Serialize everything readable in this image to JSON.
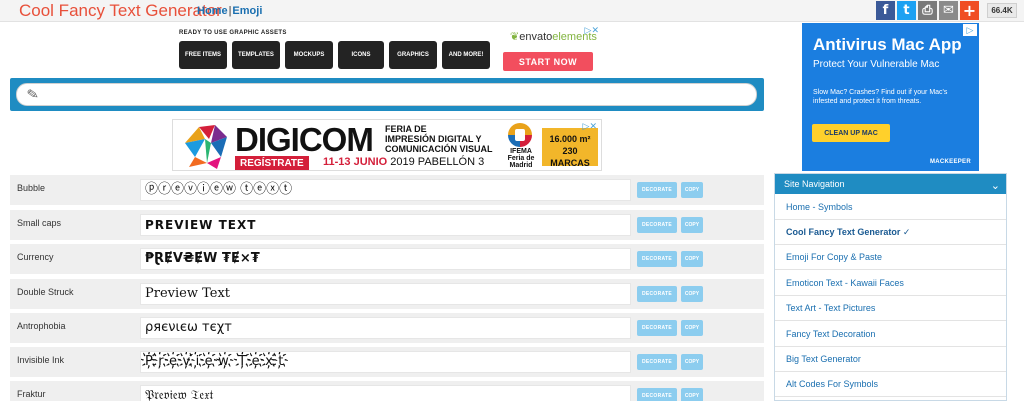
{
  "header": {
    "logo": "Cool Fancy Text Generator",
    "nav": {
      "home": "Home",
      "separator": "|",
      "emoji": "Emoji"
    },
    "share": {
      "facebook": "f",
      "twitter": "t",
      "print": "⎙",
      "email": "✉",
      "plus": "+",
      "count": "66.4K"
    }
  },
  "envato_ad": {
    "kicker": "READY TO USE GRAPHIC ASSETS",
    "chips": [
      "FREE ITEMS",
      "TEMPLATES",
      "MOCKUPS",
      "ICONS",
      "GRAPHICS",
      "AND MORE!"
    ],
    "brand_main": "envato",
    "brand_suffix": "elements",
    "cta": "START NOW",
    "ad_mark": "▷✕"
  },
  "input": {
    "icon": "pencil-icon",
    "glyph": "✎",
    "value": ""
  },
  "digicom_ad": {
    "headline": "DIGICOM",
    "subtitle_1": "FERIA DE",
    "subtitle_2": "IMPRESIÓN DIGITAL Y",
    "subtitle_3": "COMUNICACIÓN VISUAL",
    "register": "REGÍSTRATE",
    "dates": "11-13 JUNIO",
    "year_place": "2019 PABELLÓN 3",
    "org_1": "IFEMA",
    "org_2": "Feria de",
    "org_3": "Madrid",
    "stat_1": "16.000 m²",
    "stat_2": "230 MARCAS",
    "ad_mark": "▷✕"
  },
  "rows": [
    {
      "label": "Bubble",
      "preview": "ⓟⓡⓔⓥⓘⓔⓦ ⓣⓔⓧⓣ"
    },
    {
      "label": "Small caps",
      "preview": "PREVIEW TEXT"
    },
    {
      "label": "Currency",
      "preview": "₱ⱤɆV₴ɆW ₮Ɇ×₮"
    },
    {
      "label": "Double Struck",
      "preview": "Preview Text"
    },
    {
      "label": "Antrophobia",
      "preview": "ρяєνιєω тєχт"
    },
    {
      "label": "Invisible Ink",
      "preview": "P҉r҉e҉v҉i҉e҉w҉ T҉e҉x҉t҉"
    },
    {
      "label": "Fraktur",
      "preview": "𝔓𝔯𝔢𝔳𝔦𝔢𝔴 𝔗𝔢𝔵𝔱"
    }
  ],
  "buttons": {
    "decorate": "DECORATE",
    "copy": "COPY"
  },
  "antivirus_ad": {
    "title": "Antivirus Mac App",
    "subtitle": "Protect Your Vulnerable Mac",
    "body": "Slow Mac? Crashes? Find out if your Mac's infested and protect it from threats.",
    "cta": "CLEAN UP MAC",
    "brand": "MACKEEPER",
    "ad_mark": "▷"
  },
  "site_nav": {
    "title": "Site Navigation",
    "chevron": "⌄",
    "items": [
      "Home - Symbols",
      "Cool Fancy Text Generator ✓",
      "Emoji For Copy & Paste",
      "Emoticon Text - Kawaii Faces",
      "Text Art - Text Pictures",
      "Fancy Text Decoration",
      "Big Text Generator",
      "Alt Codes For Symbols"
    ],
    "active_index": 1
  }
}
